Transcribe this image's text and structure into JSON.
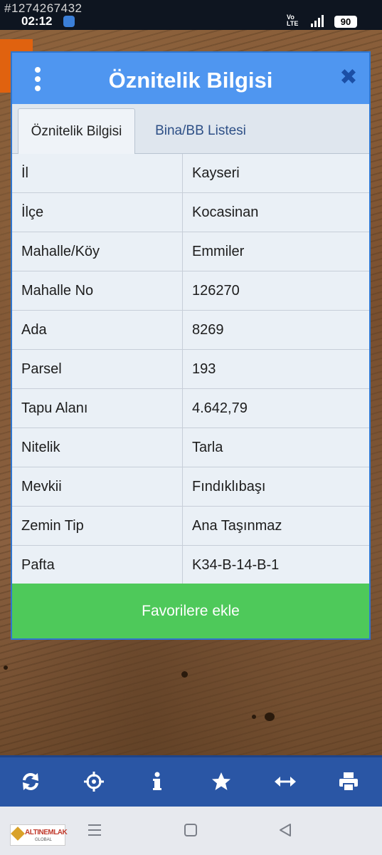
{
  "status_bar": {
    "watermark_id": "#1274267432",
    "time": "02:12",
    "network_label": "Vo LTE",
    "signal_label": "LTE",
    "battery": "90"
  },
  "dialog": {
    "title": "Öznitelik Bilgisi",
    "tabs": [
      {
        "label": "Öznitelik Bilgisi",
        "active": true
      },
      {
        "label": "Bina/BB Listesi",
        "active": false
      }
    ],
    "rows": [
      {
        "label": "İl",
        "value": "Kayseri"
      },
      {
        "label": "İlçe",
        "value": "Kocasinan"
      },
      {
        "label": "Mahalle/Köy",
        "value": "Emmiler"
      },
      {
        "label": "Mahalle No",
        "value": "126270"
      },
      {
        "label": "Ada",
        "value": "8269"
      },
      {
        "label": "Parsel",
        "value": "193"
      },
      {
        "label": "Tapu Alanı",
        "value": "4.642,79"
      },
      {
        "label": "Nitelik",
        "value": "Tarla"
      },
      {
        "label": "Mevkii",
        "value": "Fındıklıbaşı"
      },
      {
        "label": "Zemin Tip",
        "value": "Ana Taşınmaz"
      },
      {
        "label": "Pafta",
        "value": "K34-B-14-B-1"
      }
    ],
    "favorite_button": "Favorilere ekle"
  },
  "map_toolbar": {
    "tools": [
      "refresh-icon",
      "locate-icon",
      "info-icon",
      "star-icon",
      "measure-icon",
      "print-icon"
    ]
  },
  "nav_bar": {
    "brand": "ALTINEMLAK",
    "brand_sub": "GLOBAL"
  },
  "colors": {
    "header_blue": "#4f96f0",
    "close_blue": "#1b4fa6",
    "favorite_green": "#4ec95a",
    "toolbar_blue": "#2a56a5"
  }
}
